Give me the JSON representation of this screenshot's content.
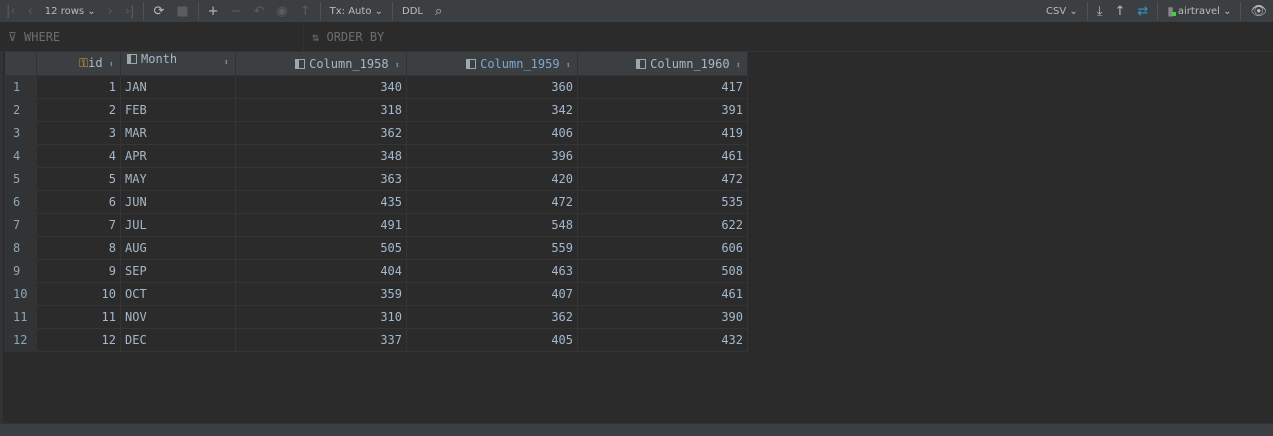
{
  "toolbar": {
    "rows_label": "12 rows",
    "tx_label": "Tx: Auto",
    "ddl_label": "DDL",
    "export_format": "CSV",
    "datasource": "airtravel",
    "datasource_status_color": "#3fd33f"
  },
  "filter": {
    "where_placeholder": "WHERE",
    "order_by_placeholder": "ORDER BY"
  },
  "table": {
    "columns": [
      "id",
      "Month",
      "Column_1958",
      "Column_1959",
      "Column_1960"
    ],
    "rows": [
      [
        "1",
        "JAN",
        "340",
        "360",
        "417"
      ],
      [
        "2",
        "FEB",
        "318",
        "342",
        "391"
      ],
      [
        "3",
        "MAR",
        "362",
        "406",
        "419"
      ],
      [
        "4",
        "APR",
        "348",
        "396",
        "461"
      ],
      [
        "5",
        "MAY",
        "363",
        "420",
        "472"
      ],
      [
        "6",
        "JUN",
        "435",
        "472",
        "535"
      ],
      [
        "7",
        "JUL",
        "491",
        "548",
        "622"
      ],
      [
        "8",
        "AUG",
        "505",
        "559",
        "606"
      ],
      [
        "9",
        "SEP",
        "404",
        "463",
        "508"
      ],
      [
        "10",
        "OCT",
        "359",
        "407",
        "461"
      ],
      [
        "11",
        "NOV",
        "310",
        "362",
        "390"
      ],
      [
        "12",
        "DEC",
        "337",
        "405",
        "432"
      ]
    ]
  }
}
